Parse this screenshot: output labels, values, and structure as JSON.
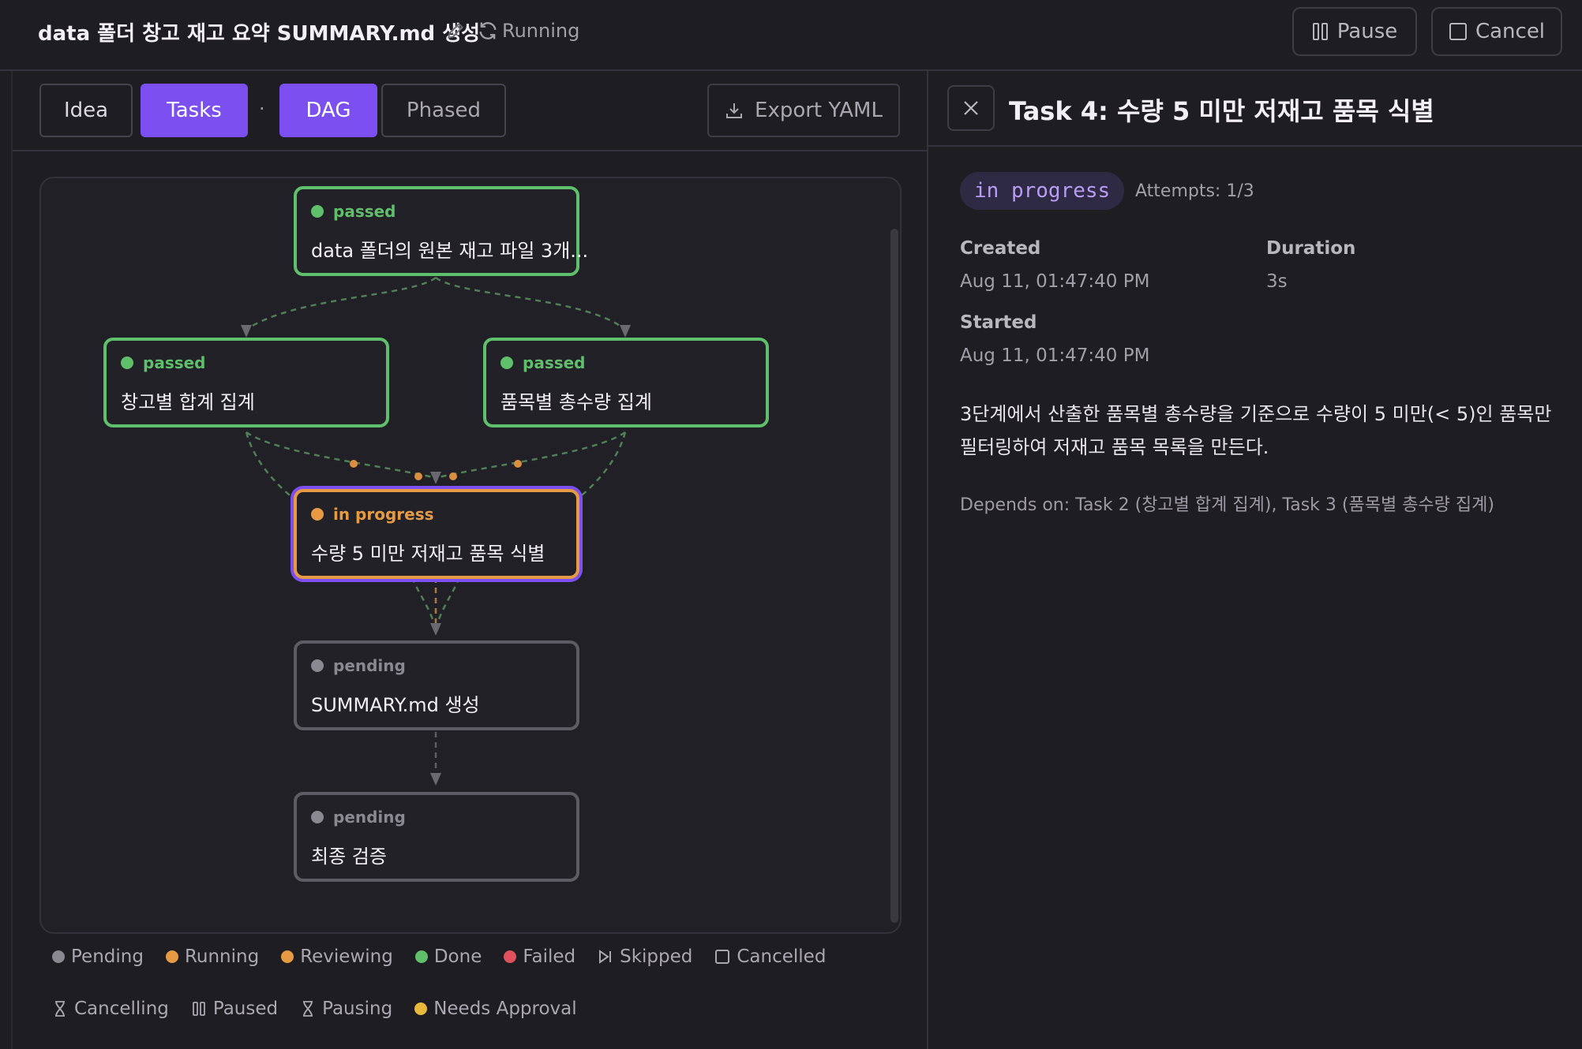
{
  "header": {
    "title": "data 폴더 창고 재고 요약 SUMMARY.md 생성",
    "status": "Running",
    "pause_label": "Pause",
    "cancel_label": "Cancel"
  },
  "toolbar": {
    "tabs": [
      "Idea",
      "Tasks",
      "DAG",
      "Phased"
    ],
    "separator": "·",
    "export_label": "Export YAML"
  },
  "dag": {
    "nodes": [
      {
        "status": "passed",
        "label": "data 폴더의 원본 재고 파일 3개..."
      },
      {
        "status": "passed",
        "label": "창고별 합계 집계"
      },
      {
        "status": "passed",
        "label": "품목별 총수량 집계"
      },
      {
        "status": "in progress",
        "label": "수량 5 미만 저재고 품목 식별"
      },
      {
        "status": "pending",
        "label": "SUMMARY.md 생성"
      },
      {
        "status": "pending",
        "label": "최종 검증"
      }
    ],
    "colors": {
      "passed": "#5fbf6a",
      "in_progress": "#e59a43",
      "pending": "#5d5c64",
      "selected": "#7b4ff0"
    }
  },
  "legend": {
    "row1": [
      "Pending",
      "Running",
      "Reviewing",
      "Done",
      "Failed",
      "Skipped",
      "Cancelled"
    ],
    "row2": [
      "Cancelling",
      "Paused",
      "Pausing",
      "Needs Approval"
    ],
    "colors": {
      "pending": "#8a8890",
      "running": "#e59a43",
      "reviewing": "#e59a43",
      "done": "#5fbf6a",
      "failed": "#e0505d",
      "needs_approval": "#e8b93a"
    }
  },
  "detail": {
    "title": "Task 4: 수량 5 미만 저재고 품목 식별",
    "badge": "in progress",
    "attempts": "Attempts: 1/3",
    "created_label": "Created",
    "created_value": "Aug 11, 01:47:40 PM",
    "duration_label": "Duration",
    "duration_value": "3s",
    "started_label": "Started",
    "started_value": "Aug 11, 01:47:40 PM",
    "description": "3단계에서 산출한 품목별 총수량을 기준으로 수량이 5 미만(< 5)인 품목만 필터링하여 저재고 품목 목록을 만든다.",
    "depends": "Depends on: Task 2 (창고별 합계 집계), Task 3 (품목별 총수량 집계)"
  }
}
